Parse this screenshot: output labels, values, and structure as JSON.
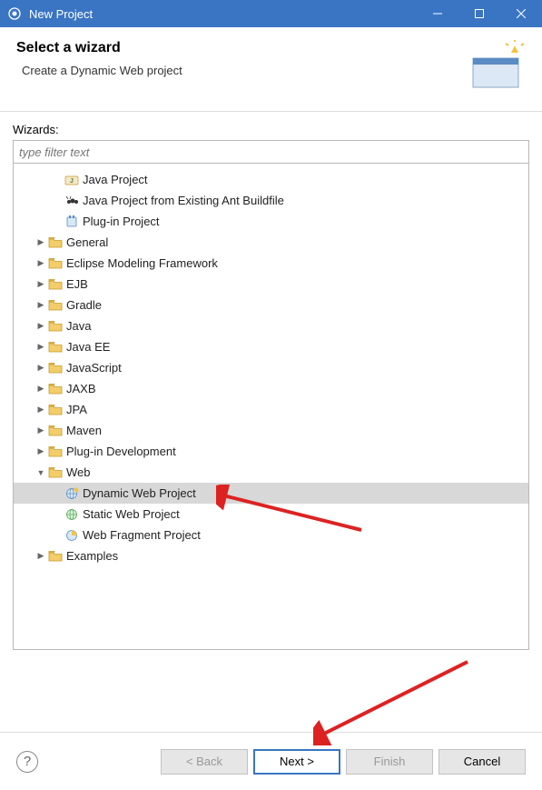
{
  "window": {
    "title": "New Project"
  },
  "header": {
    "title": "Select a wizard",
    "description": "Create a Dynamic Web project"
  },
  "wizards_label": "Wizards:",
  "filter_placeholder": "type filter text",
  "tree": [
    {
      "level": 1,
      "expander": "none",
      "icon": "java-project",
      "label": "Java Project"
    },
    {
      "level": 1,
      "expander": "none",
      "icon": "ant-project",
      "label": "Java Project from Existing Ant Buildfile"
    },
    {
      "level": 1,
      "expander": "none",
      "icon": "plugin-project",
      "label": "Plug-in Project"
    },
    {
      "level": 0,
      "expander": "closed",
      "icon": "folder",
      "label": "General"
    },
    {
      "level": 0,
      "expander": "closed",
      "icon": "folder",
      "label": "Eclipse Modeling Framework"
    },
    {
      "level": 0,
      "expander": "closed",
      "icon": "folder",
      "label": "EJB"
    },
    {
      "level": 0,
      "expander": "closed",
      "icon": "folder",
      "label": "Gradle"
    },
    {
      "level": 0,
      "expander": "closed",
      "icon": "folder",
      "label": "Java"
    },
    {
      "level": 0,
      "expander": "closed",
      "icon": "folder",
      "label": "Java EE"
    },
    {
      "level": 0,
      "expander": "closed",
      "icon": "folder",
      "label": "JavaScript"
    },
    {
      "level": 0,
      "expander": "closed",
      "icon": "folder",
      "label": "JAXB"
    },
    {
      "level": 0,
      "expander": "closed",
      "icon": "folder",
      "label": "JPA"
    },
    {
      "level": 0,
      "expander": "closed",
      "icon": "folder",
      "label": "Maven"
    },
    {
      "level": 0,
      "expander": "closed",
      "icon": "folder",
      "label": "Plug-in Development"
    },
    {
      "level": 0,
      "expander": "open",
      "icon": "folder",
      "label": "Web"
    },
    {
      "level": 1,
      "expander": "none",
      "icon": "web-dynamic",
      "label": "Dynamic Web Project",
      "selected": true
    },
    {
      "level": 1,
      "expander": "none",
      "icon": "web-static",
      "label": "Static Web Project"
    },
    {
      "level": 1,
      "expander": "none",
      "icon": "web-fragment",
      "label": "Web Fragment Project"
    },
    {
      "level": 0,
      "expander": "closed",
      "icon": "folder",
      "label": "Examples"
    }
  ],
  "buttons": {
    "back": "< Back",
    "next": "Next >",
    "finish": "Finish",
    "cancel": "Cancel"
  }
}
